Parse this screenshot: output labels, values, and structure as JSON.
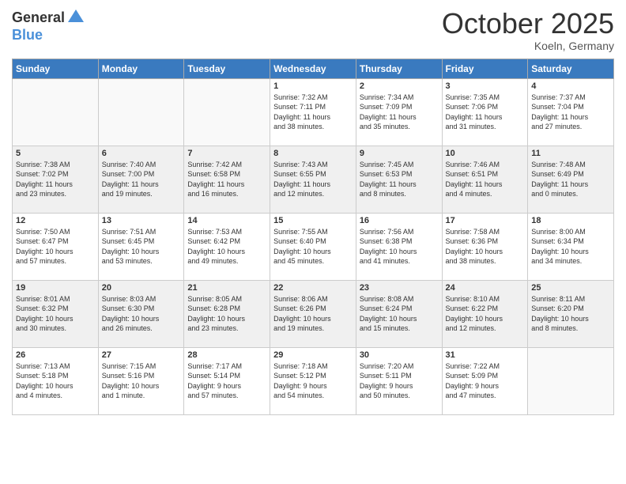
{
  "header": {
    "logo_general": "General",
    "logo_blue": "Blue",
    "month": "October 2025",
    "location": "Koeln, Germany"
  },
  "weekdays": [
    "Sunday",
    "Monday",
    "Tuesday",
    "Wednesday",
    "Thursday",
    "Friday",
    "Saturday"
  ],
  "weeks": [
    [
      {
        "day": "",
        "info": ""
      },
      {
        "day": "",
        "info": ""
      },
      {
        "day": "",
        "info": ""
      },
      {
        "day": "1",
        "info": "Sunrise: 7:32 AM\nSunset: 7:11 PM\nDaylight: 11 hours\nand 38 minutes."
      },
      {
        "day": "2",
        "info": "Sunrise: 7:34 AM\nSunset: 7:09 PM\nDaylight: 11 hours\nand 35 minutes."
      },
      {
        "day": "3",
        "info": "Sunrise: 7:35 AM\nSunset: 7:06 PM\nDaylight: 11 hours\nand 31 minutes."
      },
      {
        "day": "4",
        "info": "Sunrise: 7:37 AM\nSunset: 7:04 PM\nDaylight: 11 hours\nand 27 minutes."
      }
    ],
    [
      {
        "day": "5",
        "info": "Sunrise: 7:38 AM\nSunset: 7:02 PM\nDaylight: 11 hours\nand 23 minutes."
      },
      {
        "day": "6",
        "info": "Sunrise: 7:40 AM\nSunset: 7:00 PM\nDaylight: 11 hours\nand 19 minutes."
      },
      {
        "day": "7",
        "info": "Sunrise: 7:42 AM\nSunset: 6:58 PM\nDaylight: 11 hours\nand 16 minutes."
      },
      {
        "day": "8",
        "info": "Sunrise: 7:43 AM\nSunset: 6:55 PM\nDaylight: 11 hours\nand 12 minutes."
      },
      {
        "day": "9",
        "info": "Sunrise: 7:45 AM\nSunset: 6:53 PM\nDaylight: 11 hours\nand 8 minutes."
      },
      {
        "day": "10",
        "info": "Sunrise: 7:46 AM\nSunset: 6:51 PM\nDaylight: 11 hours\nand 4 minutes."
      },
      {
        "day": "11",
        "info": "Sunrise: 7:48 AM\nSunset: 6:49 PM\nDaylight: 11 hours\nand 0 minutes."
      }
    ],
    [
      {
        "day": "12",
        "info": "Sunrise: 7:50 AM\nSunset: 6:47 PM\nDaylight: 10 hours\nand 57 minutes."
      },
      {
        "day": "13",
        "info": "Sunrise: 7:51 AM\nSunset: 6:45 PM\nDaylight: 10 hours\nand 53 minutes."
      },
      {
        "day": "14",
        "info": "Sunrise: 7:53 AM\nSunset: 6:42 PM\nDaylight: 10 hours\nand 49 minutes."
      },
      {
        "day": "15",
        "info": "Sunrise: 7:55 AM\nSunset: 6:40 PM\nDaylight: 10 hours\nand 45 minutes."
      },
      {
        "day": "16",
        "info": "Sunrise: 7:56 AM\nSunset: 6:38 PM\nDaylight: 10 hours\nand 41 minutes."
      },
      {
        "day": "17",
        "info": "Sunrise: 7:58 AM\nSunset: 6:36 PM\nDaylight: 10 hours\nand 38 minutes."
      },
      {
        "day": "18",
        "info": "Sunrise: 8:00 AM\nSunset: 6:34 PM\nDaylight: 10 hours\nand 34 minutes."
      }
    ],
    [
      {
        "day": "19",
        "info": "Sunrise: 8:01 AM\nSunset: 6:32 PM\nDaylight: 10 hours\nand 30 minutes."
      },
      {
        "day": "20",
        "info": "Sunrise: 8:03 AM\nSunset: 6:30 PM\nDaylight: 10 hours\nand 26 minutes."
      },
      {
        "day": "21",
        "info": "Sunrise: 8:05 AM\nSunset: 6:28 PM\nDaylight: 10 hours\nand 23 minutes."
      },
      {
        "day": "22",
        "info": "Sunrise: 8:06 AM\nSunset: 6:26 PM\nDaylight: 10 hours\nand 19 minutes."
      },
      {
        "day": "23",
        "info": "Sunrise: 8:08 AM\nSunset: 6:24 PM\nDaylight: 10 hours\nand 15 minutes."
      },
      {
        "day": "24",
        "info": "Sunrise: 8:10 AM\nSunset: 6:22 PM\nDaylight: 10 hours\nand 12 minutes."
      },
      {
        "day": "25",
        "info": "Sunrise: 8:11 AM\nSunset: 6:20 PM\nDaylight: 10 hours\nand 8 minutes."
      }
    ],
    [
      {
        "day": "26",
        "info": "Sunrise: 7:13 AM\nSunset: 5:18 PM\nDaylight: 10 hours\nand 4 minutes."
      },
      {
        "day": "27",
        "info": "Sunrise: 7:15 AM\nSunset: 5:16 PM\nDaylight: 10 hours\nand 1 minute."
      },
      {
        "day": "28",
        "info": "Sunrise: 7:17 AM\nSunset: 5:14 PM\nDaylight: 9 hours\nand 57 minutes."
      },
      {
        "day": "29",
        "info": "Sunrise: 7:18 AM\nSunset: 5:12 PM\nDaylight: 9 hours\nand 54 minutes."
      },
      {
        "day": "30",
        "info": "Sunrise: 7:20 AM\nSunset: 5:11 PM\nDaylight: 9 hours\nand 50 minutes."
      },
      {
        "day": "31",
        "info": "Sunrise: 7:22 AM\nSunset: 5:09 PM\nDaylight: 9 hours\nand 47 minutes."
      },
      {
        "day": "",
        "info": ""
      }
    ]
  ]
}
